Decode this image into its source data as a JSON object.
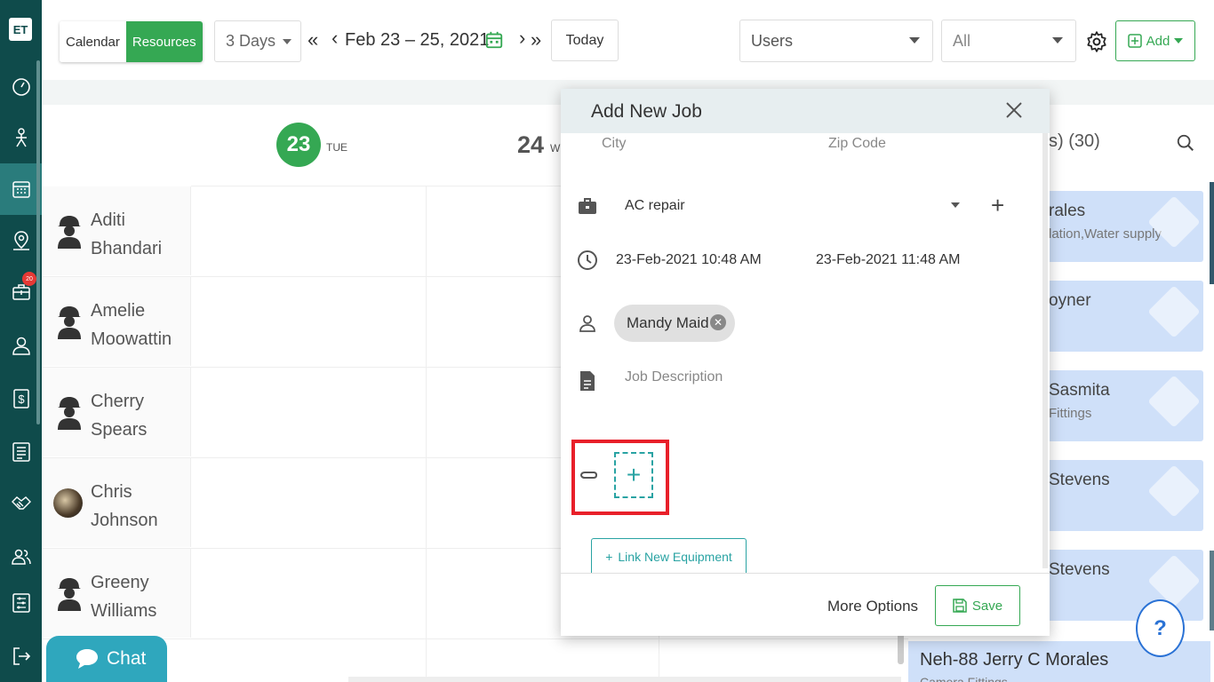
{
  "app": {
    "logo": "ET"
  },
  "sidebar": {
    "items": [
      {
        "icon": "dashboard-icon"
      },
      {
        "icon": "technician-icon"
      },
      {
        "icon": "calendar-icon",
        "active": true
      },
      {
        "icon": "map-pin-icon"
      },
      {
        "icon": "jobs-icon",
        "badge": "20"
      },
      {
        "icon": "user-icon"
      },
      {
        "icon": "dollar-icon"
      },
      {
        "icon": "list-icon"
      },
      {
        "icon": "handshake-icon"
      },
      {
        "icon": "users-icon"
      },
      {
        "icon": "settings-sliders-icon"
      },
      {
        "icon": "logout-icon"
      }
    ]
  },
  "toolbar": {
    "calendar_label": "Calendar",
    "resources_label": "Resources",
    "days_value": "3 Days",
    "date_range": "Feb 23 – 25, 2021",
    "today_label": "Today",
    "users_value": "Users",
    "all_value": "All",
    "add_label": "Add"
  },
  "scheduler": {
    "day1": {
      "num": "23",
      "label": "TUE"
    },
    "day2": {
      "num": "24",
      "label": "W"
    },
    "resources": [
      {
        "name": "Aditi Bhandari",
        "avatar": "worker-icon"
      },
      {
        "name": "Amelie Moowattin",
        "avatar": "worker-icon"
      },
      {
        "name": "Cherry Spears",
        "avatar": "worker-icon"
      },
      {
        "name": "Chris Johnson",
        "avatar": "photo"
      },
      {
        "name": "Greeny Williams",
        "avatar": "worker-icon"
      }
    ]
  },
  "right_panel": {
    "header": "s) (30)",
    "cards": [
      {
        "name": "rales",
        "sub": "lation,Water supply"
      },
      {
        "name": "oyner",
        "sub": ""
      },
      {
        "name": "Sasmita",
        "sub": "Fittings"
      },
      {
        "name": "Stevens",
        "sub": ""
      },
      {
        "name": "Stevens",
        "sub": ""
      }
    ],
    "bottom_card": {
      "name": "Neh-88 Jerry C Morales",
      "sub": "Camera Fittings"
    }
  },
  "modal": {
    "title": "Add New Job",
    "city_label": "City",
    "zip_label": "Zip Code",
    "job_type": "AC repair",
    "start_datetime": "23-Feb-2021 10:48 AM",
    "end_datetime": "23-Feb-2021 11:48 AM",
    "assignee": "Mandy Maid",
    "description_placeholder": "Job Description",
    "link_equipment_label": "Link New Equipment",
    "more_options_label": "More Options",
    "save_label": "Save"
  },
  "chat": {
    "label": "Chat"
  },
  "help": {
    "label": "?"
  },
  "colors": {
    "accent": "#35a853",
    "teal": "#29a3a3",
    "sidebar": "#0f4b4b",
    "highlight": "#e8202a"
  }
}
